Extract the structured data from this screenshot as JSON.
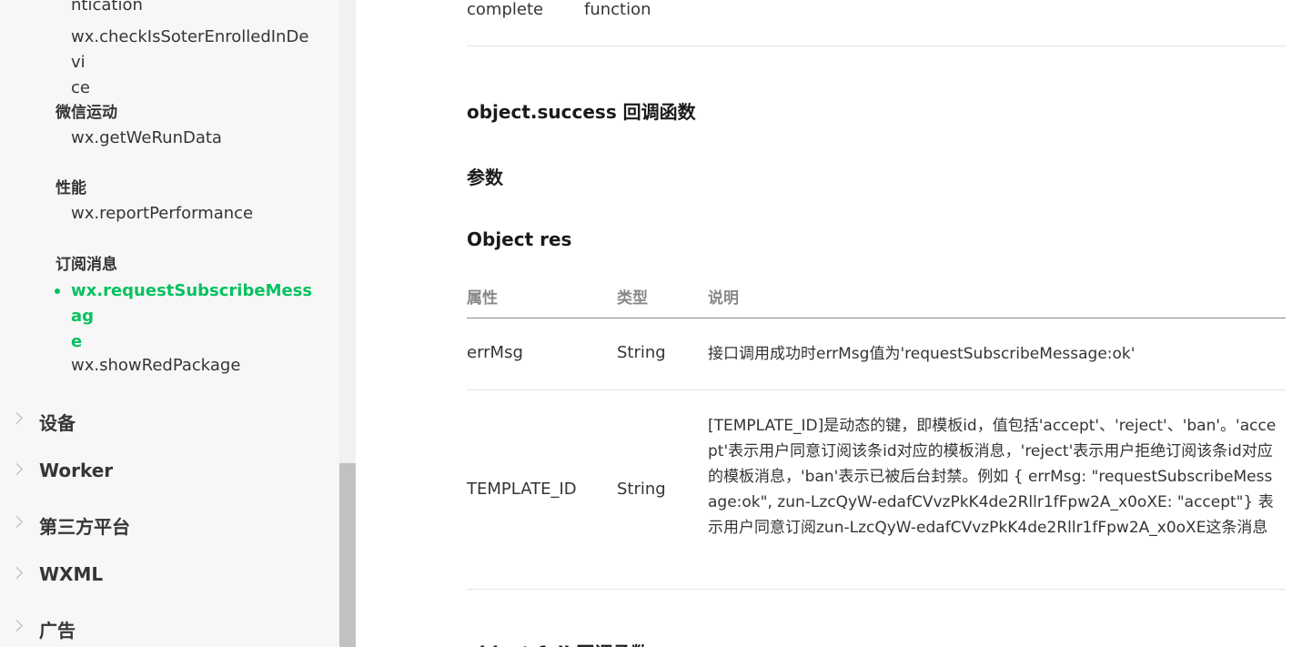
{
  "sidebar": {
    "apis": {
      "facial_partial": "ntication",
      "check_soter_line1": "wx.checkIsSoterEnrolledInDevi",
      "check_soter_line2": "ce",
      "get_we_run_data": "wx.getWeRunData",
      "report_performance": "wx.reportPerformance",
      "request_subscribe_line1": "wx.requestSubscribeMessag",
      "request_subscribe_line2": "e",
      "show_red_package": "wx.showRedPackage"
    },
    "groups": {
      "werun": "微信运动",
      "performance": "性能",
      "subscribe": "订阅消息"
    },
    "categories": [
      "设备",
      "Worker",
      "第三方平台",
      "WXML",
      "广告"
    ]
  },
  "main": {
    "top_row": {
      "name": "complete",
      "type": "function"
    },
    "success_heading": "object.success 回调函数",
    "params_heading": "参数",
    "object_res_heading": "Object res",
    "table": {
      "headers": [
        "属性",
        "类型",
        "说明"
      ],
      "rows": [
        {
          "name": "errMsg",
          "type": "String",
          "desc": "接口调用成功时errMsg值为'requestSubscribeMessage:ok'"
        },
        {
          "name": "TEMPLATE_ID",
          "type": "String",
          "desc": "[TEMPLATE_ID]是动态的键，即模板id，值包括'accept'、'reject'、'ban'。'accept'表示用户同意订阅该条id对应的模板消息，'reject'表示用户拒绝订阅该条id对应的模板消息，'ban'表示已被后台封禁。例如 { errMsg: \"requestSubscribeMessage:ok\", zun-LzcQyW-edafCVvzPkK4de2Rllr1fFpw2A_x0oXE: \"accept\"} 表示用户同意订阅zun-LzcQyW-edafCVvzPkK4de2Rllr1fFpw2A_x0oXE这条消息"
        }
      ]
    },
    "fail_heading_partial": "object.fail 回调函数"
  },
  "colors": {
    "accent": "#07c160",
    "sidebar_bg": "#f7f7f7",
    "text": "#353535"
  }
}
